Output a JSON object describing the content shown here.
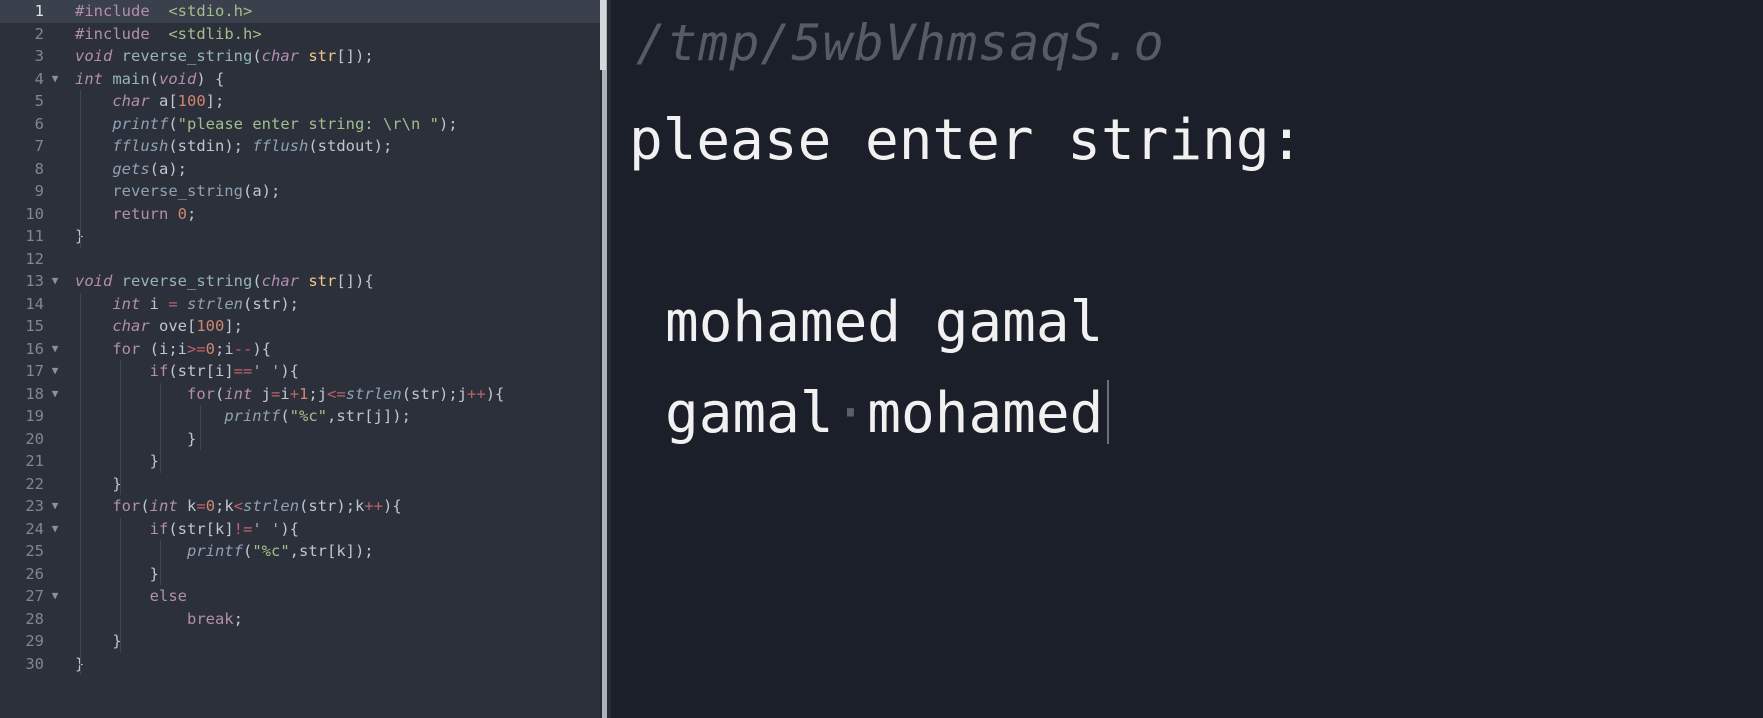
{
  "editor": {
    "current_line": 1,
    "lines": [
      {
        "n": "1",
        "fold": false
      },
      {
        "n": "2",
        "fold": false
      },
      {
        "n": "3",
        "fold": false
      },
      {
        "n": "4",
        "fold": true
      },
      {
        "n": "5",
        "fold": false
      },
      {
        "n": "6",
        "fold": false
      },
      {
        "n": "7",
        "fold": false
      },
      {
        "n": "8",
        "fold": false
      },
      {
        "n": "9",
        "fold": false
      },
      {
        "n": "10",
        "fold": false
      },
      {
        "n": "11",
        "fold": false
      },
      {
        "n": "12",
        "fold": false
      },
      {
        "n": "13",
        "fold": true
      },
      {
        "n": "14",
        "fold": false
      },
      {
        "n": "15",
        "fold": false
      },
      {
        "n": "16",
        "fold": true
      },
      {
        "n": "17",
        "fold": true
      },
      {
        "n": "18",
        "fold": true
      },
      {
        "n": "19",
        "fold": false
      },
      {
        "n": "20",
        "fold": false
      },
      {
        "n": "21",
        "fold": false
      },
      {
        "n": "22",
        "fold": false
      },
      {
        "n": "23",
        "fold": true
      },
      {
        "n": "24",
        "fold": true
      },
      {
        "n": "25",
        "fold": false
      },
      {
        "n": "26",
        "fold": false
      },
      {
        "n": "27",
        "fold": true
      },
      {
        "n": "28",
        "fold": false
      },
      {
        "n": "29",
        "fold": false
      },
      {
        "n": "30",
        "fold": false
      }
    ],
    "code": [
      [
        [
          "inc",
          "#include"
        ],
        [
          "",
          "  "
        ],
        [
          "hdr",
          "<stdio.h>"
        ]
      ],
      [
        [
          "inc",
          "#include"
        ],
        [
          "",
          "  "
        ],
        [
          "hdr",
          "<stdlib.h>"
        ]
      ],
      [
        [
          "type",
          "void"
        ],
        [
          "",
          " "
        ],
        [
          "def",
          "reverse_string"
        ],
        [
          "",
          "("
        ],
        [
          "type",
          "char"
        ],
        [
          "",
          " "
        ],
        [
          "param",
          "str"
        ],
        [
          "",
          "[]);"
        ]
      ],
      [
        [
          "type",
          "int"
        ],
        [
          "",
          " "
        ],
        [
          "def",
          "main"
        ],
        [
          "",
          "("
        ],
        [
          "type",
          "void"
        ],
        [
          "",
          ") {"
        ]
      ],
      [
        [
          "",
          "    "
        ],
        [
          "type",
          "char"
        ],
        [
          "",
          " a["
        ],
        [
          "num",
          "100"
        ],
        [
          "",
          "];"
        ]
      ],
      [
        [
          "",
          "    "
        ],
        [
          "call",
          "printf"
        ],
        [
          "",
          "("
        ],
        [
          "str",
          "\"please enter string: \\r\\n \""
        ],
        [
          "",
          ");"
        ]
      ],
      [
        [
          "",
          "    "
        ],
        [
          "call",
          "fflush"
        ],
        [
          "",
          "(stdin); "
        ],
        [
          "call",
          "fflush"
        ],
        [
          "",
          "(stdout);"
        ]
      ],
      [
        [
          "",
          "    "
        ],
        [
          "call",
          "gets"
        ],
        [
          "",
          "(a);"
        ]
      ],
      [
        [
          "",
          "    "
        ],
        [
          "fn",
          "reverse_string"
        ],
        [
          "",
          "(a);"
        ]
      ],
      [
        [
          "",
          "    "
        ],
        [
          "kw",
          "return"
        ],
        [
          "",
          " "
        ],
        [
          "num",
          "0"
        ],
        [
          "",
          ";"
        ]
      ],
      [
        [
          "",
          "}"
        ]
      ],
      [
        [
          "",
          ""
        ]
      ],
      [
        [
          "type",
          "void"
        ],
        [
          "",
          " "
        ],
        [
          "def",
          "reverse_string"
        ],
        [
          "",
          "("
        ],
        [
          "type",
          "char"
        ],
        [
          "",
          " "
        ],
        [
          "param",
          "str"
        ],
        [
          "",
          "[]){"
        ]
      ],
      [
        [
          "",
          "    "
        ],
        [
          "type",
          "int"
        ],
        [
          "",
          " i "
        ],
        [
          "op",
          "="
        ],
        [
          "",
          " "
        ],
        [
          "call",
          "strlen"
        ],
        [
          "",
          "(str);"
        ]
      ],
      [
        [
          "",
          "    "
        ],
        [
          "type",
          "char"
        ],
        [
          "",
          " ove["
        ],
        [
          "num",
          "100"
        ],
        [
          "",
          "];"
        ]
      ],
      [
        [
          "",
          "    "
        ],
        [
          "kw",
          "for"
        ],
        [
          "",
          " (i;i"
        ],
        [
          "op",
          ">="
        ],
        [
          "num",
          "0"
        ],
        [
          "",
          ";i"
        ],
        [
          "op",
          "--"
        ],
        [
          "",
          "){"
        ]
      ],
      [
        [
          "",
          "        "
        ],
        [
          "kw",
          "if"
        ],
        [
          "",
          "(str[i]"
        ],
        [
          "op",
          "=="
        ],
        [
          "str",
          "' '"
        ],
        [
          "",
          "){"
        ]
      ],
      [
        [
          "",
          "            "
        ],
        [
          "kw",
          "for"
        ],
        [
          "",
          "("
        ],
        [
          "type",
          "int"
        ],
        [
          "",
          " j"
        ],
        [
          "op",
          "="
        ],
        [
          "",
          "i"
        ],
        [
          "op",
          "+"
        ],
        [
          "num",
          "1"
        ],
        [
          "",
          ";j"
        ],
        [
          "op",
          "<="
        ],
        [
          "call",
          "strlen"
        ],
        [
          "",
          "(str);j"
        ],
        [
          "op",
          "++"
        ],
        [
          "",
          "){"
        ]
      ],
      [
        [
          "",
          "                "
        ],
        [
          "call",
          "printf"
        ],
        [
          "",
          "("
        ],
        [
          "str",
          "\"%c\""
        ],
        [
          "",
          ",str[j]);"
        ]
      ],
      [
        [
          "",
          "            }"
        ]
      ],
      [
        [
          "",
          "        }"
        ]
      ],
      [
        [
          "",
          "    }"
        ]
      ],
      [
        [
          "",
          "    "
        ],
        [
          "kw",
          "for"
        ],
        [
          "",
          "("
        ],
        [
          "type",
          "int"
        ],
        [
          "",
          " k"
        ],
        [
          "op",
          "="
        ],
        [
          "num",
          "0"
        ],
        [
          "",
          ";k"
        ],
        [
          "op",
          "<"
        ],
        [
          "call",
          "strlen"
        ],
        [
          "",
          "(str);k"
        ],
        [
          "op",
          "++"
        ],
        [
          "",
          "){"
        ]
      ],
      [
        [
          "",
          "        "
        ],
        [
          "kw",
          "if"
        ],
        [
          "",
          "(str[k]"
        ],
        [
          "op",
          "!="
        ],
        [
          "str",
          "' '"
        ],
        [
          "",
          "){"
        ]
      ],
      [
        [
          "",
          "            "
        ],
        [
          "call",
          "printf"
        ],
        [
          "",
          "("
        ],
        [
          "str",
          "\"%c\""
        ],
        [
          "",
          ",str[k]);"
        ]
      ],
      [
        [
          "",
          "        }"
        ]
      ],
      [
        [
          "",
          "        "
        ],
        [
          "kw",
          "else"
        ]
      ],
      [
        [
          "",
          "            "
        ],
        [
          "kw",
          "break"
        ],
        [
          "",
          ";"
        ]
      ],
      [
        [
          "",
          "    }"
        ]
      ],
      [
        [
          "",
          "}"
        ]
      ]
    ]
  },
  "terminal": {
    "path": "/tmp/5wbVhmsaqS.o",
    "prompt": "please enter string:",
    "input": "mohamed gamal",
    "output_first": "gamal",
    "output_sep": "·",
    "output_second": "mohamed"
  }
}
